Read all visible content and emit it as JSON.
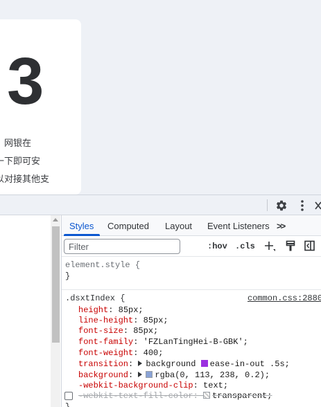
{
  "page": {
    "big_number": "3",
    "card_lines": [
      "款，网银在",
      "击一下即可安",
      "可以对接其他支"
    ]
  },
  "devtools": {
    "toolbar": {
      "settings_icon": "gear-icon",
      "menu_icon": "vertical-dots-icon",
      "close_icon": "close-icon"
    },
    "tabs": [
      {
        "label": "Styles",
        "active": true
      },
      {
        "label": "Computed",
        "active": false
      },
      {
        "label": "Layout",
        "active": false
      },
      {
        "label": "Event Listeners",
        "active": false
      },
      {
        "label": ">>",
        "active": false
      }
    ],
    "filter": {
      "placeholder": "Filter",
      "hov": ":hov",
      "cls": ".cls",
      "add_icon": "plus-icon",
      "paint_icon": "paint-brush-icon",
      "sidebar_icon": "sidebar-toggle-icon"
    },
    "element_style": {
      "selector": "element.style {",
      "close": "}"
    },
    "rule": {
      "selector": ".dsxtIndex {",
      "source": "common.css:2880",
      "close": "}",
      "declarations": [
        {
          "prop": "height",
          "value": "85px;"
        },
        {
          "prop": "line-height",
          "value": "85px;"
        },
        {
          "prop": "font-size",
          "value": "85px;"
        },
        {
          "prop": "font-family",
          "value": "'FZLanTingHei-B-GBK';"
        },
        {
          "prop": "font-weight",
          "value": "400;"
        },
        {
          "prop": "transition",
          "value_parts": [
            "background",
            "ease-in-out .5s;"
          ]
        },
        {
          "prop": "background",
          "value": "rgba(0, 113, 238, 0.2);"
        },
        {
          "prop": "-webkit-background-clip",
          "value": "text;"
        },
        {
          "prop": "-webkit-text-fill-color",
          "value": "transparent;",
          "disabled": true
        }
      ]
    },
    "colors": {
      "accent": "#0b57d0",
      "property": "#c80000",
      "big_number": "#2e3033"
    }
  }
}
